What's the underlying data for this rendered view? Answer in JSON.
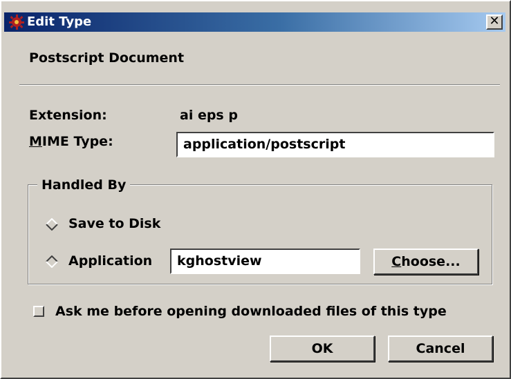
{
  "window": {
    "title": "Edit Type",
    "close_label": "x",
    "description": "Postscript Document"
  },
  "extension": {
    "label": "Extension:",
    "value": "ai eps p"
  },
  "mime": {
    "label_mnemonic": "M",
    "label_rest": "IME Type:",
    "value": "application/postscript"
  },
  "handled_by": {
    "title": "Handled By",
    "save_to_disk_label": "Save to Disk",
    "application_label": "Application",
    "application_value": "kghostview",
    "choose_mnemonic": "C",
    "choose_rest": "hoose...",
    "selected": "Application"
  },
  "ask_checkbox": {
    "label": "Ask me before opening downloaded files of this type",
    "checked": false
  },
  "buttons": {
    "ok": "OK",
    "cancel": "Cancel"
  },
  "colors": {
    "titlebar_start": "#0a246a",
    "titlebar_end": "#a6caf0",
    "face": "#d4d0c8"
  },
  "icons": {
    "app": "kde-gear-icon",
    "close": "close-icon"
  }
}
